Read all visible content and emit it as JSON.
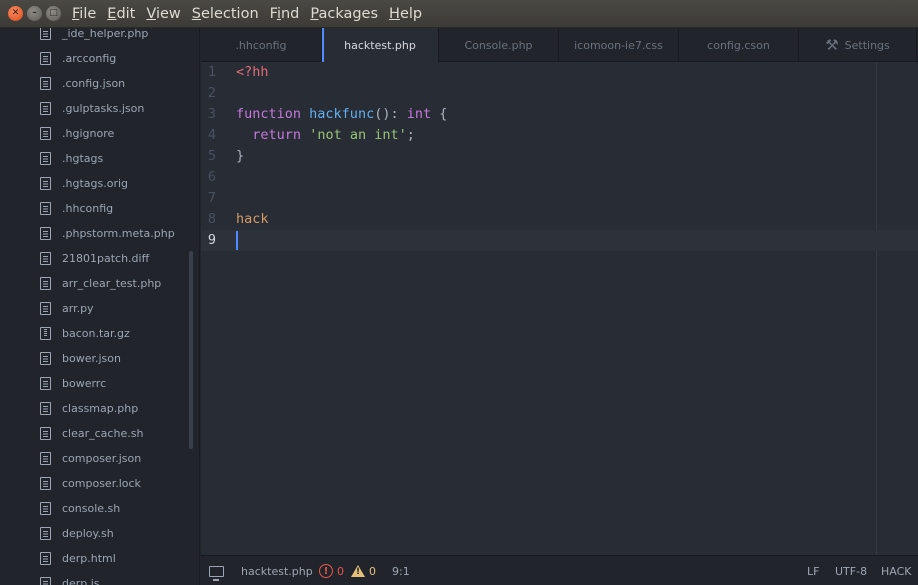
{
  "menubar": {
    "items": [
      "File",
      "Edit",
      "View",
      "Selection",
      "Find",
      "Packages",
      "Help"
    ],
    "underlined": [
      "F",
      "E",
      "V",
      "S",
      "i",
      "P",
      "H"
    ]
  },
  "sidebar": {
    "files": [
      {
        "name": "_ide_helper.php",
        "icon": "file-text-icon"
      },
      {
        "name": ".arcconfig",
        "icon": "file-text-icon"
      },
      {
        "name": ".config.json",
        "icon": "file-text-icon"
      },
      {
        "name": ".gulptasks.json",
        "icon": "file-text-icon"
      },
      {
        "name": ".hgignore",
        "icon": "file-text-icon"
      },
      {
        "name": ".hgtags",
        "icon": "file-text-icon"
      },
      {
        "name": ".hgtags.orig",
        "icon": "file-text-icon"
      },
      {
        "name": ".hhconfig",
        "icon": "file-text-icon"
      },
      {
        "name": ".phpstorm.meta.php",
        "icon": "file-text-icon"
      },
      {
        "name": "21801patch.diff",
        "icon": "file-text-icon"
      },
      {
        "name": "arr_clear_test.php",
        "icon": "file-text-icon"
      },
      {
        "name": "arr.py",
        "icon": "file-text-icon"
      },
      {
        "name": "bacon.tar.gz",
        "icon": "file-zip-icon"
      },
      {
        "name": "bower.json",
        "icon": "file-text-icon"
      },
      {
        "name": "bowerrc",
        "icon": "file-text-icon"
      },
      {
        "name": "classmap.php",
        "icon": "file-text-icon"
      },
      {
        "name": "clear_cache.sh",
        "icon": "file-text-icon"
      },
      {
        "name": "composer.json",
        "icon": "file-text-icon"
      },
      {
        "name": "composer.lock",
        "icon": "file-text-icon"
      },
      {
        "name": "console.sh",
        "icon": "file-text-icon"
      },
      {
        "name": "deploy.sh",
        "icon": "file-text-icon"
      },
      {
        "name": "derp.html",
        "icon": "file-text-icon"
      },
      {
        "name": "derp.js",
        "icon": "file-text-icon"
      }
    ]
  },
  "tabs": [
    {
      "label": ".hhconfig",
      "active": false
    },
    {
      "label": "hacktest.php",
      "active": true
    },
    {
      "label": "Console.php",
      "active": false
    },
    {
      "label": "icomoon-ie7.css",
      "active": false
    },
    {
      "label": "config.cson",
      "active": false
    },
    {
      "label": "Settings",
      "active": false,
      "icon": "tools-icon"
    }
  ],
  "editor": {
    "lines": [
      {
        "n": "1",
        "tokens": [
          {
            "t": "<?hh",
            "c": "tag"
          }
        ]
      },
      {
        "n": "2",
        "tokens": []
      },
      {
        "n": "3",
        "tokens": [
          {
            "t": "function",
            "c": "kw"
          },
          {
            "t": " ",
            "c": ""
          },
          {
            "t": "hackfunc",
            "c": "fn"
          },
          {
            "t": "(): ",
            "c": ""
          },
          {
            "t": "int",
            "c": "kw"
          },
          {
            "t": " {",
            "c": ""
          }
        ]
      },
      {
        "n": "4",
        "tokens": [
          {
            "t": "  ",
            "c": ""
          },
          {
            "t": "return",
            "c": "kw"
          },
          {
            "t": " ",
            "c": ""
          },
          {
            "t": "'not an int'",
            "c": "str"
          },
          {
            "t": ";",
            "c": ""
          }
        ]
      },
      {
        "n": "5",
        "tokens": [
          {
            "t": "}",
            "c": ""
          }
        ]
      },
      {
        "n": "6",
        "tokens": []
      },
      {
        "n": "7",
        "tokens": []
      },
      {
        "n": "8",
        "tokens": [
          {
            "t": "hack",
            "c": "hack"
          }
        ]
      },
      {
        "n": "9",
        "tokens": [],
        "current": true
      }
    ]
  },
  "statusbar": {
    "file": "hacktest.php",
    "errors": "0",
    "warnings": "0",
    "cursor": "9:1",
    "line_ending": "LF",
    "encoding": "UTF-8",
    "grammar": "HACK"
  },
  "colors": {
    "accent": "#528bff",
    "error": "#e45649",
    "warning": "#e5c07b"
  }
}
